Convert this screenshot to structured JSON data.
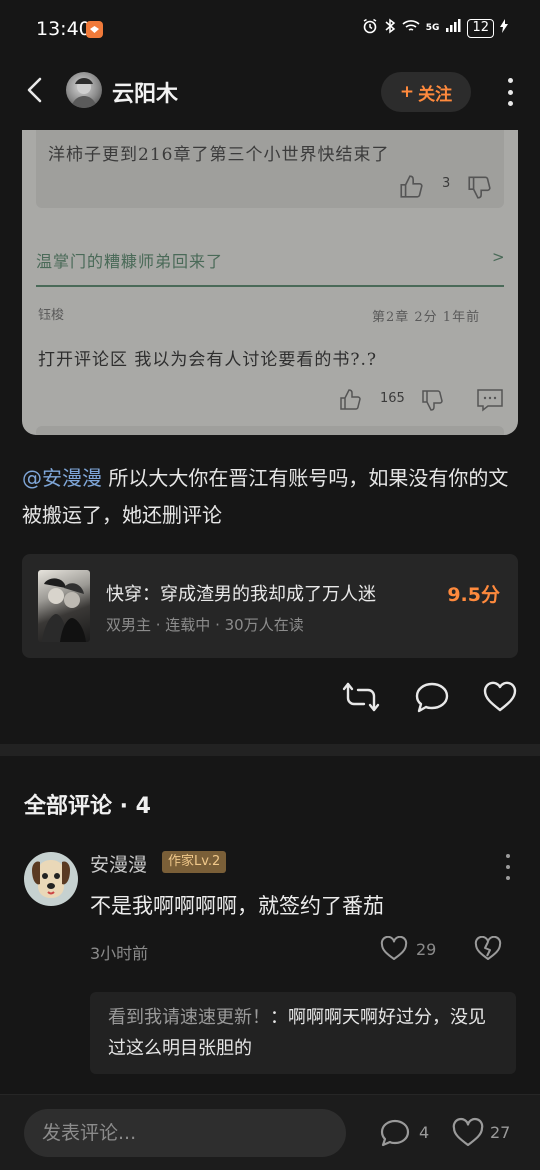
{
  "status_bar": {
    "time": "13:40",
    "network": "5G",
    "battery": "12"
  },
  "top_bar": {
    "author_name": "云阳木",
    "follow_label": "关注",
    "follow_plus": "+"
  },
  "screenshot": {
    "top_comment": "洋柿子更到216章了第三个小世界快结束了",
    "top_like_count": "3",
    "book_link": "温掌门的糟糠师弟回来了",
    "book_arrow": ">",
    "user": "钰梭",
    "meta": "第2章  2分  1年前",
    "comment": "打开评论区 我以为会有人讨论要看的书?.?",
    "like_count": "165"
  },
  "post": {
    "mention": "@安漫漫",
    "text": " 所以大大你在晋江有账号吗，如果没有你的文被搬运了，她还删评论"
  },
  "book": {
    "title": "快穿：穿成渣男的我却成了万人迷",
    "score": "9.5分",
    "meta": "双男主 · 连载中 · 30万人在读"
  },
  "comments_section": {
    "header": "全部评论 · 4"
  },
  "comment": {
    "user": "安漫漫",
    "badge": "作家Lv.2",
    "body": "不是我啊啊啊啊，就签约了番茄",
    "time": "3小时前",
    "like_count": "29"
  },
  "reply": {
    "user": "看到我请速速更新！",
    "text": "：啊啊啊天啊好过分，没见过这么明目张胆的"
  },
  "bottom_bar": {
    "placeholder": "发表评论...",
    "comment_count": "4",
    "like_count": "27"
  },
  "colors": {
    "background": "#161616",
    "accent": "#ff8a3d",
    "mention": "#7fa6d8",
    "badge_bg": "#7a5f38"
  }
}
